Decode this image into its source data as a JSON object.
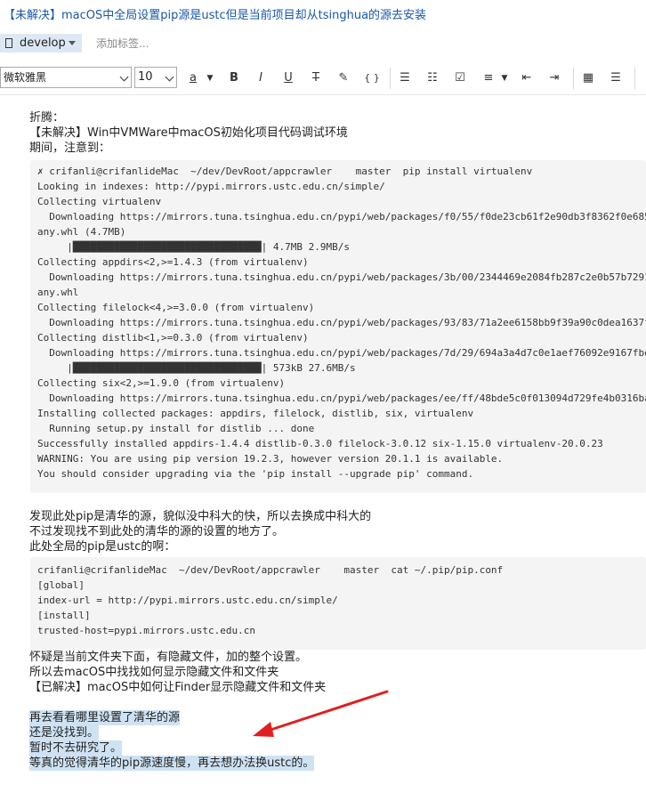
{
  "title": "【未解决】macOS中全局设置pip源是ustc但是当前项目却从tsinghua的源去安装",
  "branch": "develop",
  "add_tag": "添加标签...",
  "toolbar": {
    "font": "微软雅黑",
    "size": "10",
    "buttons": [
      "a",
      "B",
      "I",
      "U",
      "T",
      "✎",
      "{ }",
      "☰",
      "☷",
      "☑",
      "≡",
      "⇤",
      "⇥",
      "▦",
      "☰"
    ]
  },
  "intro": [
    "折腾：",
    "【未解决】Win中VMWare中macOS初始化项目代码调试环境",
    "期间，注意到："
  ],
  "code1": [
    "✗ crifanli@crifanlideMac  ~/dev/DevRoot/appcrawler    master  pip install virtualenv",
    "Looking in indexes: http://pypi.mirrors.ustc.edu.cn/simple/",
    "Collecting virtualenv",
    "  Downloading https://mirrors.tuna.tsinghua.edu.cn/pypi/web/packages/f0/55/f0de23cb61f2e90db3f8362f0e685",
    "any.whl (4.7MB)",
    "     |████████████████████████████████| 4.7MB 2.9MB/s",
    "Collecting appdirs<2,>=1.4.3 (from virtualenv)",
    "  Downloading https://mirrors.tuna.tsinghua.edu.cn/pypi/web/packages/3b/00/2344469e2084fb287c2e0b57b7291",
    "any.whl",
    "Collecting filelock<4,>=3.0.0 (from virtualenv)",
    "  Downloading https://mirrors.tuna.tsinghua.edu.cn/pypi/web/packages/93/83/71a2ee6158bb9f39a90c0dea1637f",
    "Collecting distlib<1,>=0.3.0 (from virtualenv)",
    "  Downloading https://mirrors.tuna.tsinghua.edu.cn/pypi/web/packages/7d/29/694a3a4d7c0e1aef76092e9167fbe",
    "     |████████████████████████████████| 573kB 27.6MB/s",
    "Collecting six<2,>=1.9.0 (from virtualenv)",
    "  Downloading https://mirrors.tuna.tsinghua.edu.cn/pypi/web/packages/ee/ff/48bde5c0f013094d729fe4b0316ba",
    "Installing collected packages: appdirs, filelock, distlib, six, virtualenv",
    "  Running setup.py install for distlib ... done",
    "Successfully installed appdirs-1.4.4 distlib-0.3.0 filelock-3.0.12 six-1.15.0 virtualenv-20.0.23",
    "WARNING: You are using pip version 19.2.3, however version 20.1.1 is available.",
    "You should consider upgrading via the 'pip install --upgrade pip' command."
  ],
  "mid": [
    "发现此处pip是清华的源，貌似没中科大的快，所以去换成中科大的",
    "不过发现找不到此处的清华的源的设置的地方了。",
    "此处全局的pip是ustc的啊："
  ],
  "code2": [
    "crifanli@crifanlideMac  ~/dev/DevRoot/appcrawler    master  cat ~/.pip/pip.conf",
    "[global]",
    "index-url = http://pypi.mirrors.ustc.edu.cn/simple/",
    "[install]",
    "trusted-host=pypi.mirrors.ustc.edu.cn"
  ],
  "after": [
    "怀疑是当前文件夹下面，有隐藏文件，加的整个设置。",
    "所以去macOS中找找如何显示隐藏文件和文件夹",
    "【已解决】macOS中如何让Finder显示隐藏文件和文件夹"
  ],
  "highlighted": [
    "再去看看哪里设置了清华的源",
    "还是没找到。",
    "暂时不去研究了。",
    "等真的觉得清华的pip源速度慢，再去想办法换ustc的。"
  ],
  "colors": {
    "title": "#1a57a8",
    "highlight": "#cfe2f3",
    "arrow": "#e02020",
    "code_bg": "#f4f4f4"
  }
}
